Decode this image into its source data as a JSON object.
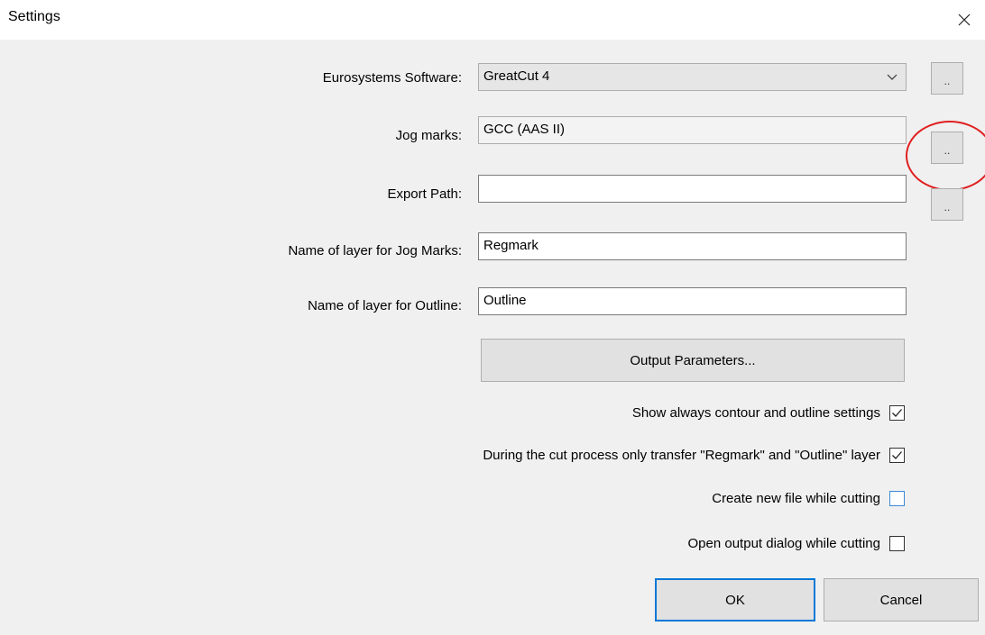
{
  "window": {
    "title": "Settings",
    "close_icon": "close-icon"
  },
  "form": {
    "software_label": "Eurosystems Software:",
    "software_value": "GreatCut 4",
    "software_browse": "..",
    "jog_label": "Jog marks:",
    "jog_value": "GCC (AAS II)",
    "jog_browse": "..",
    "export_label": "Export Path:",
    "export_value": "",
    "export_browse": "..",
    "jog_layer_label": "Name of layer for Jog Marks:",
    "jog_layer_value": "Regmark",
    "outline_layer_label": "Name of layer for Outline:",
    "outline_layer_value": "Outline",
    "output_params_label": "Output Parameters..."
  },
  "options": [
    {
      "label": "Show always contour and outline settings",
      "checked": true
    },
    {
      "label": "During the cut process only transfer \"Regmark\" and \"Outline\" layer",
      "checked": true
    },
    {
      "label": "Create new file while cutting",
      "checked": false
    },
    {
      "label": "Open output dialog while cutting",
      "checked": false
    }
  ],
  "footer": {
    "ok_label": "OK",
    "cancel_label": "Cancel"
  },
  "annotation": {
    "color": "#e02020"
  }
}
